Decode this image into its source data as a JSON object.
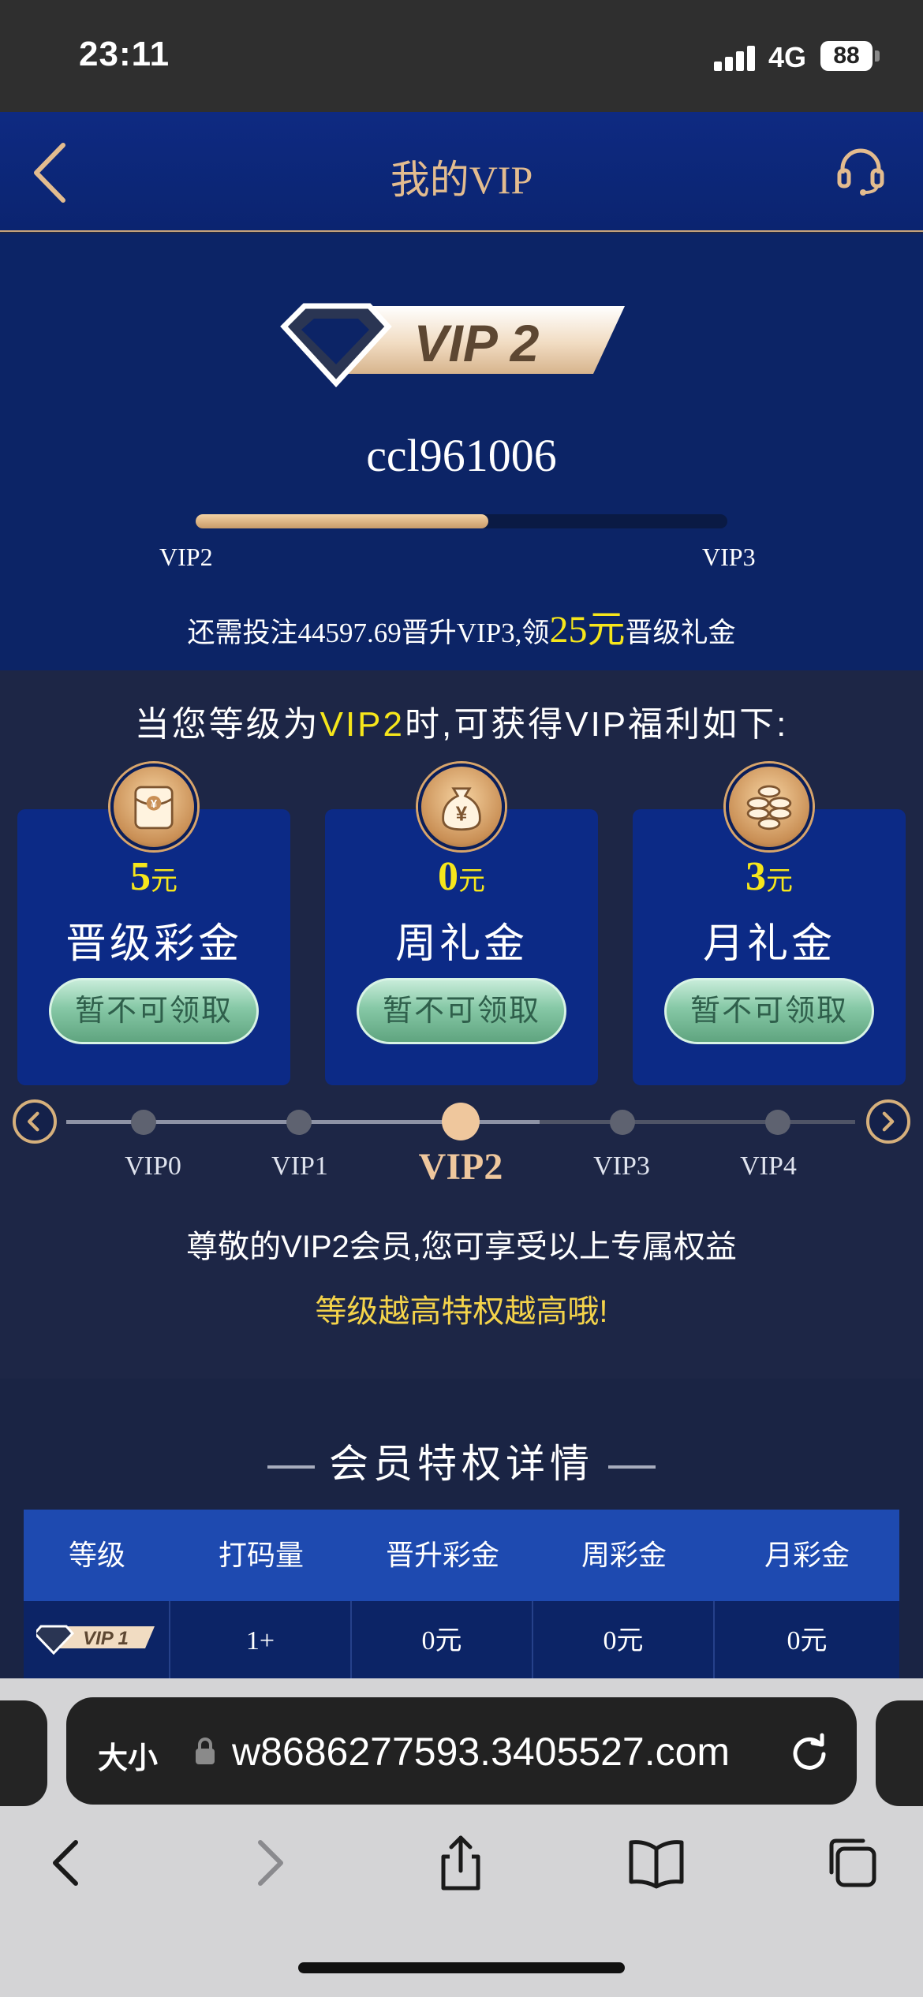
{
  "status": {
    "time": "23:11",
    "network": "4G",
    "battery": "88"
  },
  "nav": {
    "title": "我的VIP",
    "back_icon": "chevron-left-icon",
    "service_icon": "headset-icon"
  },
  "vip": {
    "badge_text": "VIP 2",
    "username": "ccl961006",
    "progress_fraction": 0.55,
    "from_level": "VIP2",
    "to_level": "VIP3",
    "upgrade_prefix": "还需投注44597.69晋升VIP3,领",
    "upgrade_amount": "25元",
    "upgrade_suffix": "晋级礼金"
  },
  "benefits": {
    "title_prefix": "当您等级为",
    "title_level": "VIP2",
    "title_suffix": "时,可获得VIP福利如下:",
    "cards": [
      {
        "icon": "red-envelope-icon",
        "value": "5",
        "unit": "元",
        "label": "晋级彩金",
        "button": "暂不可领取"
      },
      {
        "icon": "money-bag-icon",
        "value": "0",
        "unit": "元",
        "label": "周礼金",
        "button": "暂不可领取"
      },
      {
        "icon": "coin-stack-icon",
        "value": "3",
        "unit": "元",
        "label": "月礼金",
        "button": "暂不可领取"
      }
    ]
  },
  "levels": {
    "items": [
      "VIP0",
      "VIP1",
      "VIP2",
      "VIP3",
      "VIP4"
    ],
    "active_index": 2
  },
  "respect_text": "尊敬的VIP2会员,您可享受以上专属权益",
  "motto": "等级越高特权越高哦!",
  "detail": {
    "title": "会员特权详情",
    "columns": [
      "等级",
      "打码量",
      "晋升彩金",
      "周彩金",
      "月彩金"
    ],
    "rows": [
      {
        "level_badge": "VIP 1",
        "cells": [
          "1+",
          "0元",
          "0元",
          "0元"
        ]
      }
    ]
  },
  "browser": {
    "text_size": "大小",
    "url": "w8686277593.3405527.com"
  },
  "colors": {
    "accent_gold": "#e3bc8f",
    "highlight_yellow": "#f6e61b",
    "header_blue": "#0e2a82",
    "card_blue": "#0c2a86",
    "button_green": "#86c8a6"
  }
}
